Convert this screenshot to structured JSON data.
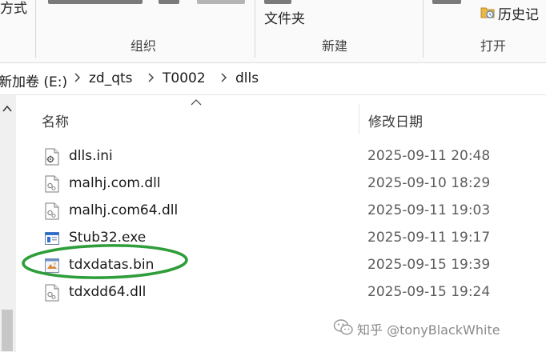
{
  "ribbon": {
    "partial_label_left": "方式",
    "new_folder_label": "文件夹",
    "history_label": "历史记",
    "groups": [
      {
        "label": "组织"
      },
      {
        "label": "新建"
      },
      {
        "label": "打开"
      }
    ]
  },
  "address": {
    "crumbs": [
      "新加卷 (E:)",
      "zd_qts",
      "T0002",
      "dlls"
    ]
  },
  "columns": {
    "name": "名称",
    "modified": "修改日期"
  },
  "files": [
    {
      "name": "dlls.ini",
      "modified": "2025-09-11 20:48",
      "icon": "ini-settings-icon"
    },
    {
      "name": "malhj.com.dll",
      "modified": "2025-09-10 18:29",
      "icon": "dll-file-icon"
    },
    {
      "name": "malhj.com64.dll",
      "modified": "2025-09-11 19:03",
      "icon": "dll-file-icon"
    },
    {
      "name": "Stub32.exe",
      "modified": "2025-09-11 19:17",
      "icon": "exe-application-icon"
    },
    {
      "name": "tdxdatas.bin",
      "modified": "2025-09-15 19:39",
      "icon": "bin-file-icon"
    },
    {
      "name": "tdxdd64.dll",
      "modified": "2025-09-15 19:24",
      "icon": "dll-file-icon"
    }
  ],
  "annotation": {
    "highlight_color": "#2e9d3a",
    "highlighted_file": "tdxdatas.bin"
  },
  "watermark": {
    "text": "知乎 @tonyBlackWhite"
  }
}
